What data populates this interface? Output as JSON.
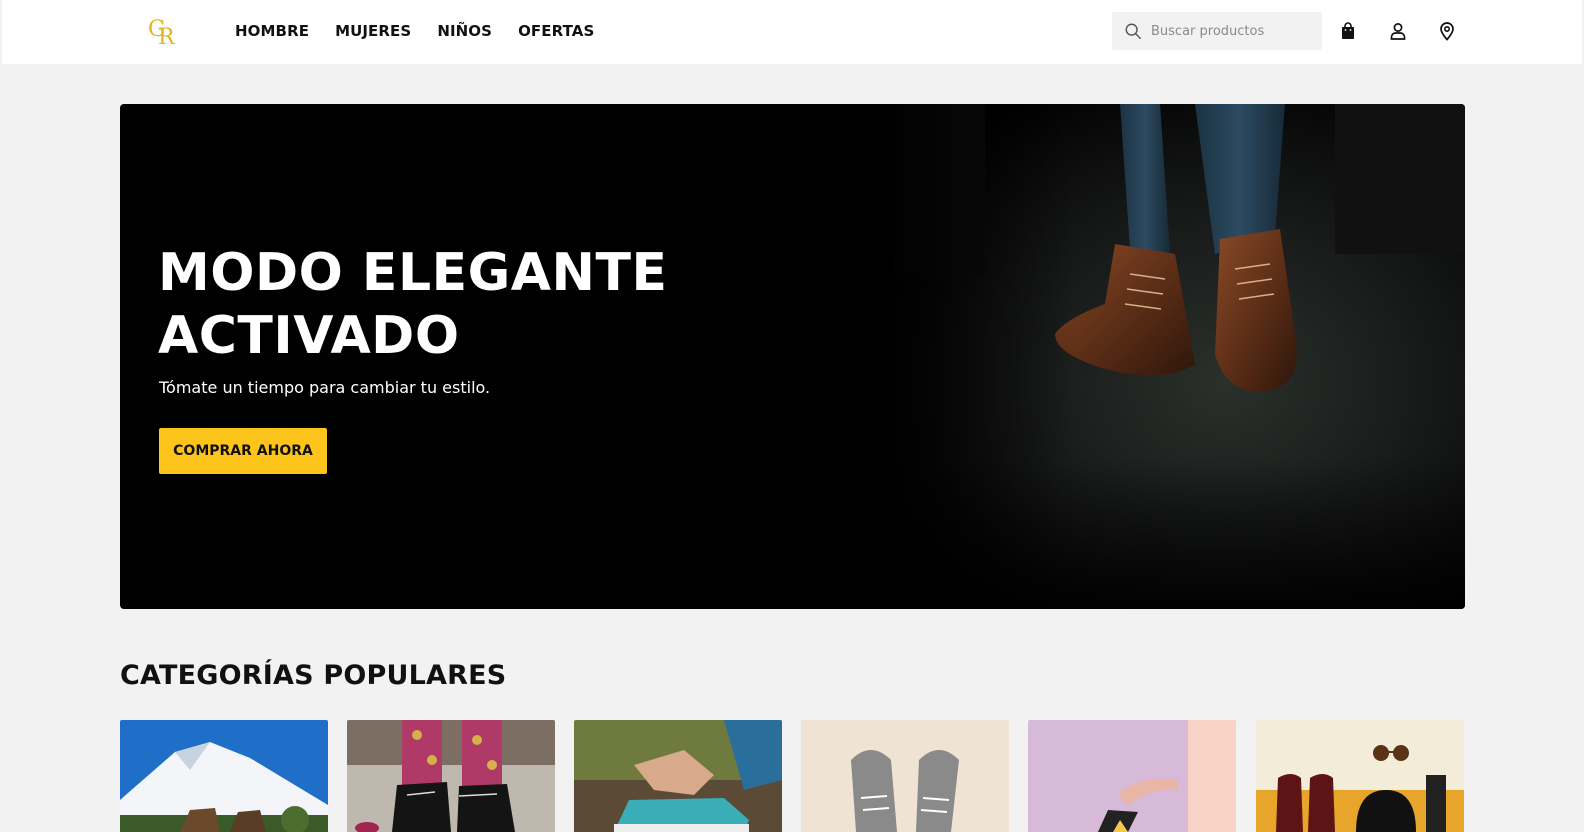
{
  "brand": {
    "logo_letters": "GR",
    "color": "#e4b422"
  },
  "nav": {
    "items": [
      {
        "label": "HOMBRE"
      },
      {
        "label": "MUJERES"
      },
      {
        "label": "NIÑOS"
      },
      {
        "label": "OFERTAS"
      }
    ]
  },
  "search": {
    "placeholder": "Buscar productos",
    "value": ""
  },
  "header_icons": [
    "shopping-bag-icon",
    "user-icon",
    "location-pin-icon"
  ],
  "hero": {
    "title": "MODO ELEGANTE\nACTIVADO",
    "subtitle": "Tómate un tiempo para cambiar tu estilo.",
    "cta_label": "COMPRAR AHORA",
    "cta_color": "#fdc41c"
  },
  "categories": {
    "title": "CATEGORÍAS POPULARES",
    "cards": [
      {
        "image": "mountain-boots-photo"
      },
      {
        "image": "black-oxfords-polka-socks-photo"
      },
      {
        "image": "tying-blue-sneaker-photo"
      },
      {
        "image": "grey-canvas-sneakers-photo"
      },
      {
        "image": "heel-on-pink-photo"
      },
      {
        "image": "loafers-hat-sunglasses-photo"
      }
    ]
  },
  "colors": {
    "page_bg": "#f2f2f2",
    "accent": "#fdc41c",
    "text": "#111111"
  }
}
